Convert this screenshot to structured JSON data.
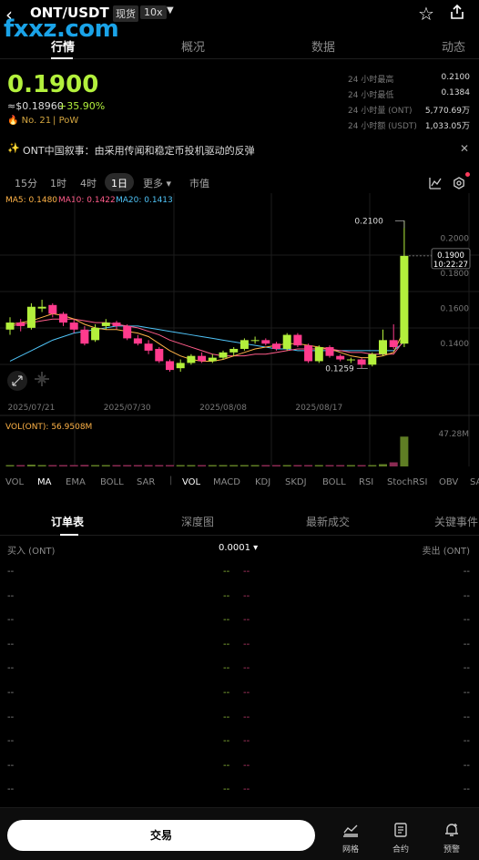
{
  "header": {
    "pair": "ONT/USDT",
    "spot_tag": "现货",
    "leverage_tag": "10x"
  },
  "watermark": "fxxz.com",
  "tabs": [
    {
      "label": "行情",
      "active": true
    },
    {
      "label": "概况"
    },
    {
      "label": "数据"
    },
    {
      "label": "动态"
    }
  ],
  "price": {
    "last": "0.1900",
    "fiat": "≈$0.18960",
    "change": "+35.90%",
    "rank": "No. 21",
    "consensus": "PoW"
  },
  "stats": [
    {
      "label": "24 小时最高",
      "value": "0.2100"
    },
    {
      "label": "24 小时最低",
      "value": "0.1384"
    },
    {
      "label": "24 小时量 (ONT)",
      "value": "5,770.69万"
    },
    {
      "label": "24 小时额 (USDT)",
      "value": "1,033.05万"
    }
  ],
  "news": "ONT中国叙事：由采用传闻和稳定币投机驱动的反弹",
  "intervals": [
    "15分",
    "1时",
    "4时",
    "1日",
    "更多",
    "市值"
  ],
  "active_interval": "1日",
  "ma_labels": [
    {
      "text": "MA5: 0.1480",
      "color": "#ffb347"
    },
    {
      "text": "MA10: 0.1422",
      "color": "#ff5c8a"
    },
    {
      "text": "MA20: 0.1413",
      "color": "#4fc3f7"
    }
  ],
  "chart_data": {
    "type": "candlestick",
    "y_ticks": [
      "0.2000",
      "0.1800",
      "0.1600",
      "0.1400"
    ],
    "x_ticks": [
      "2025/07/21",
      "2025/07/30",
      "2025/08/08",
      "2025/08/17"
    ],
    "max_label": "0.2100",
    "min_label": "0.1259",
    "current_price_label": "0.1900",
    "countdown": "10:22:27",
    "ylim": [
      0.11,
      0.2195
    ],
    "candles": [
      {
        "o": 0.148,
        "c": 0.152,
        "h": 0.155,
        "l": 0.145
      },
      {
        "o": 0.152,
        "c": 0.15,
        "h": 0.154,
        "l": 0.147
      },
      {
        "o": 0.149,
        "c": 0.161,
        "h": 0.163,
        "l": 0.148
      },
      {
        "o": 0.16,
        "c": 0.161,
        "h": 0.165,
        "l": 0.158
      },
      {
        "o": 0.162,
        "c": 0.157,
        "h": 0.163,
        "l": 0.155
      },
      {
        "o": 0.157,
        "c": 0.152,
        "h": 0.158,
        "l": 0.15
      },
      {
        "o": 0.152,
        "c": 0.148,
        "h": 0.154,
        "l": 0.146
      },
      {
        "o": 0.148,
        "c": 0.14,
        "h": 0.15,
        "l": 0.139
      },
      {
        "o": 0.142,
        "c": 0.149,
        "h": 0.151,
        "l": 0.141
      },
      {
        "o": 0.15,
        "c": 0.152,
        "h": 0.154,
        "l": 0.148
      },
      {
        "o": 0.152,
        "c": 0.15,
        "h": 0.153,
        "l": 0.148
      },
      {
        "o": 0.15,
        "c": 0.143,
        "h": 0.151,
        "l": 0.142
      },
      {
        "o": 0.143,
        "c": 0.14,
        "h": 0.145,
        "l": 0.139
      },
      {
        "o": 0.14,
        "c": 0.136,
        "h": 0.142,
        "l": 0.134
      },
      {
        "o": 0.137,
        "c": 0.13,
        "h": 0.138,
        "l": 0.129
      },
      {
        "o": 0.13,
        "c": 0.125,
        "h": 0.131,
        "l": 0.124
      },
      {
        "o": 0.126,
        "c": 0.129,
        "h": 0.131,
        "l": 0.124
      },
      {
        "o": 0.129,
        "c": 0.133,
        "h": 0.134,
        "l": 0.128
      },
      {
        "o": 0.133,
        "c": 0.13,
        "h": 0.135,
        "l": 0.129
      },
      {
        "o": 0.13,
        "c": 0.132,
        "h": 0.134,
        "l": 0.129
      },
      {
        "o": 0.132,
        "c": 0.135,
        "h": 0.136,
        "l": 0.131
      },
      {
        "o": 0.135,
        "c": 0.137,
        "h": 0.138,
        "l": 0.133
      },
      {
        "o": 0.137,
        "c": 0.142,
        "h": 0.143,
        "l": 0.136
      },
      {
        "o": 0.142,
        "c": 0.142,
        "h": 0.144,
        "l": 0.14
      },
      {
        "o": 0.142,
        "c": 0.14,
        "h": 0.143,
        "l": 0.139
      },
      {
        "o": 0.14,
        "c": 0.137,
        "h": 0.141,
        "l": 0.136
      },
      {
        "o": 0.137,
        "c": 0.145,
        "h": 0.146,
        "l": 0.136
      },
      {
        "o": 0.145,
        "c": 0.139,
        "h": 0.146,
        "l": 0.138
      },
      {
        "o": 0.139,
        "c": 0.13,
        "h": 0.14,
        "l": 0.129
      },
      {
        "o": 0.13,
        "c": 0.138,
        "h": 0.139,
        "l": 0.129
      },
      {
        "o": 0.138,
        "c": 0.133,
        "h": 0.139,
        "l": 0.132
      },
      {
        "o": 0.133,
        "c": 0.131,
        "h": 0.134,
        "l": 0.13
      },
      {
        "o": 0.131,
        "c": 0.131,
        "h": 0.132,
        "l": 0.129
      },
      {
        "o": 0.131,
        "c": 0.128,
        "h": 0.132,
        "l": 0.126
      },
      {
        "o": 0.128,
        "c": 0.134,
        "h": 0.135,
        "l": 0.127
      },
      {
        "o": 0.134,
        "c": 0.142,
        "h": 0.148,
        "l": 0.133
      },
      {
        "o": 0.142,
        "c": 0.138,
        "h": 0.151,
        "l": 0.137
      },
      {
        "o": 0.14,
        "c": 0.19,
        "h": 0.21,
        "l": 0.138
      }
    ],
    "ma5": [
      0.151,
      0.152,
      0.153,
      0.155,
      0.157,
      0.156,
      0.154,
      0.151,
      0.149,
      0.148,
      0.148,
      0.147,
      0.146,
      0.144,
      0.14,
      0.136,
      0.133,
      0.131,
      0.13,
      0.13,
      0.131,
      0.133,
      0.135,
      0.137,
      0.138,
      0.139,
      0.14,
      0.14,
      0.139,
      0.138,
      0.137,
      0.135,
      0.133,
      0.132,
      0.132,
      0.133,
      0.135,
      0.148
    ],
    "ma10": [
      0.15,
      0.151,
      0.152,
      0.153,
      0.154,
      0.154,
      0.154,
      0.153,
      0.152,
      0.152,
      0.151,
      0.15,
      0.149,
      0.147,
      0.145,
      0.142,
      0.14,
      0.138,
      0.136,
      0.134,
      0.133,
      0.133,
      0.133,
      0.134,
      0.134,
      0.135,
      0.136,
      0.137,
      0.137,
      0.137,
      0.137,
      0.136,
      0.135,
      0.135,
      0.134,
      0.134,
      0.134,
      0.142
    ],
    "ma20": [
      0.13,
      0.133,
      0.136,
      0.139,
      0.142,
      0.144,
      0.146,
      0.147,
      0.148,
      0.149,
      0.15,
      0.15,
      0.15,
      0.149,
      0.148,
      0.147,
      0.146,
      0.145,
      0.144,
      0.143,
      0.142,
      0.141,
      0.14,
      0.139,
      0.138,
      0.137,
      0.137,
      0.136,
      0.136,
      0.136,
      0.136,
      0.136,
      0.136,
      0.136,
      0.136,
      0.136,
      0.136,
      0.141
    ],
    "volume": {
      "label": "VOL(ONT): 56.9508M",
      "max_label": "47.28M",
      "max": 52,
      "values": [
        2.1,
        1.5,
        2.8,
        2.2,
        1.9,
        2.0,
        1.7,
        2.4,
        2.0,
        1.6,
        1.5,
        1.9,
        1.8,
        1.7,
        2.1,
        2.0,
        1.4,
        1.3,
        1.2,
        1.3,
        1.4,
        1.5,
        1.9,
        1.4,
        1.3,
        1.2,
        2.0,
        1.6,
        1.8,
        1.4,
        1.3,
        1.2,
        1.5,
        1.6,
        1.9,
        3.6,
        6.5,
        47.28
      ]
    }
  },
  "indicators": [
    "VOL",
    "MA",
    "EMA",
    "BOLL",
    "SAR",
    "VOL",
    "MACD",
    "KDJ",
    "SKDJ",
    "BOLL",
    "RSI",
    "StochRSI",
    "OBV",
    "SAR"
  ],
  "order_book": {
    "tabs": [
      "订单表",
      "深度图",
      "最新成交",
      "关键事件"
    ],
    "buy_label": "买入 (ONT)",
    "precision": "0.0001",
    "sell_label": "卖出 (ONT)",
    "rows": 10,
    "placeholder": "--"
  },
  "bottom": {
    "trade": "交易",
    "items": [
      "网格",
      "合约",
      "预警"
    ]
  }
}
